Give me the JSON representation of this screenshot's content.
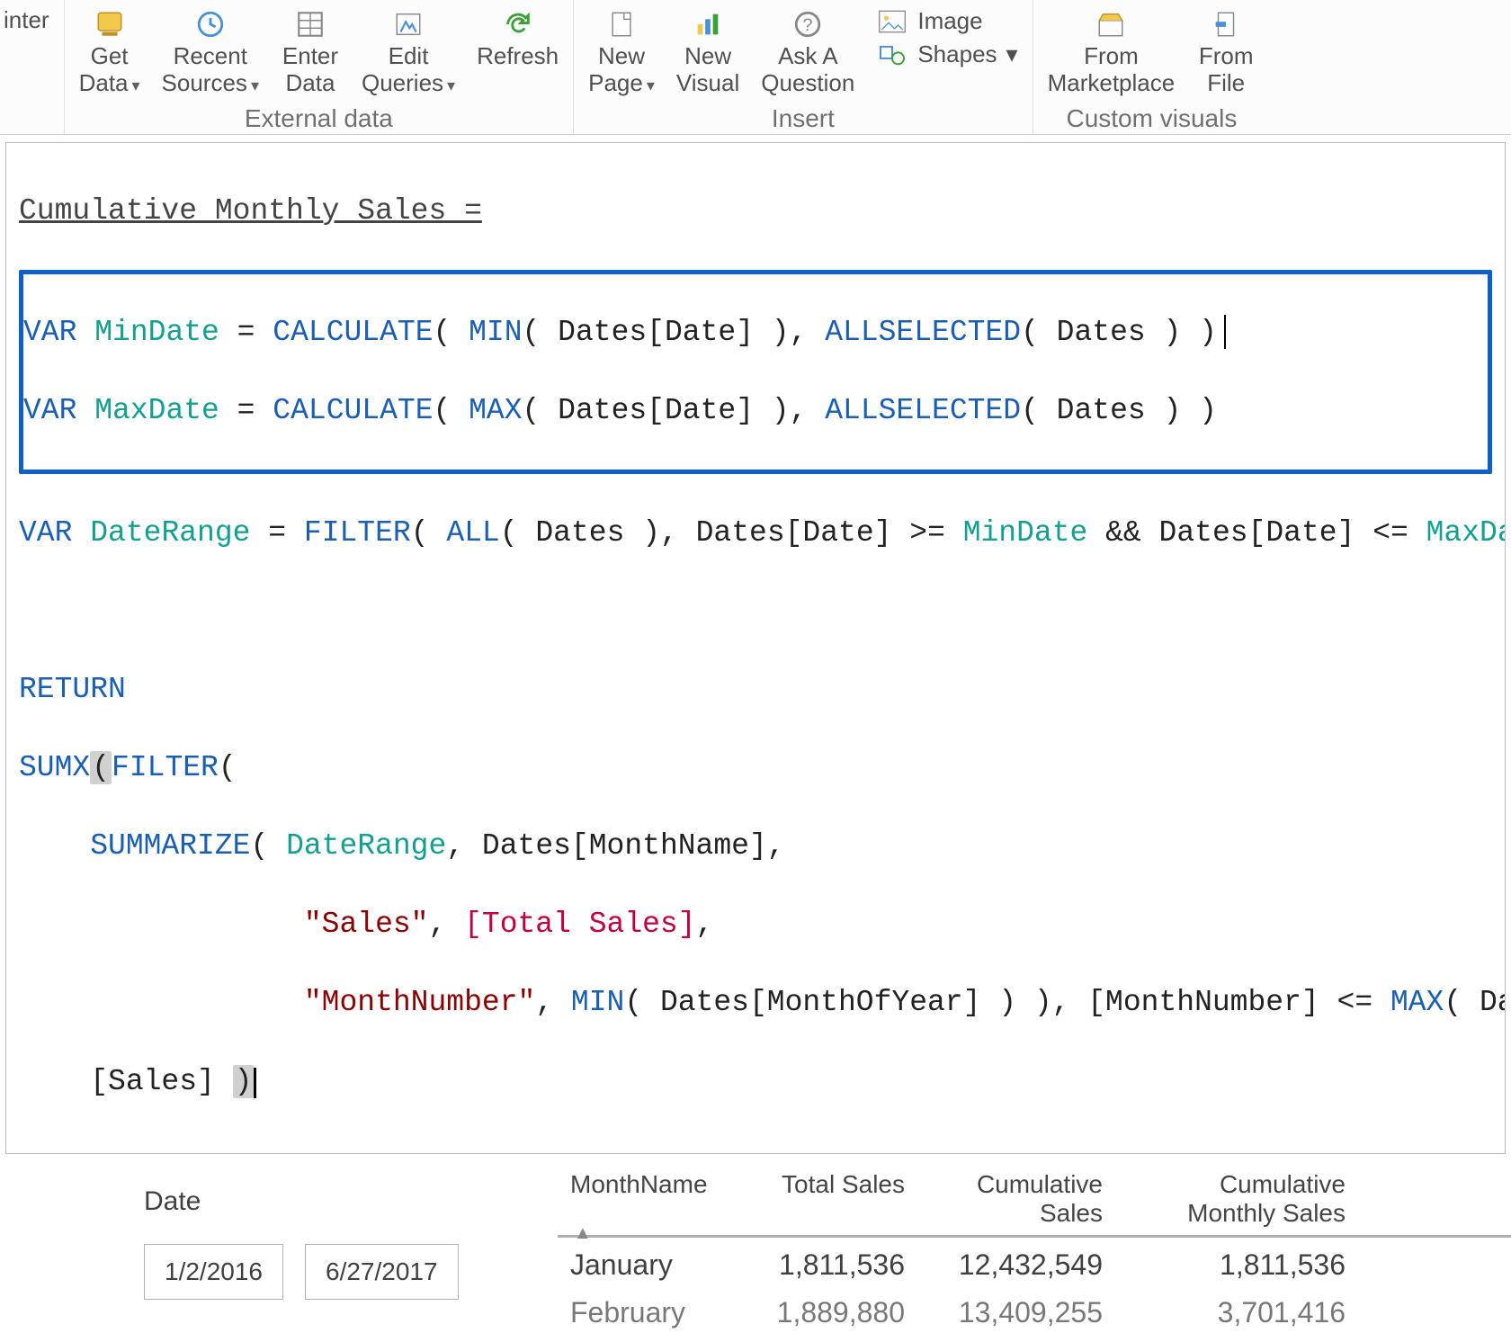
{
  "ribbon": {
    "painter": {
      "label": "inter"
    },
    "get_data": {
      "label": "Get\nData"
    },
    "recent_sources": {
      "label": "Recent\nSources"
    },
    "enter_data": {
      "label": "Enter\nData"
    },
    "edit_queries": {
      "label": "Edit\nQueries"
    },
    "refresh": {
      "label": "Refresh"
    },
    "external_data_section": "External data",
    "new_page": {
      "label": "New\nPage"
    },
    "new_visual": {
      "label": "New\nVisual"
    },
    "ask_a_question": {
      "label": "Ask A\nQuestion"
    },
    "image": {
      "label": "Image"
    },
    "shapes": {
      "label": "Shapes"
    },
    "insert_section": "Insert",
    "from_marketplace": {
      "label": "From\nMarketplace"
    },
    "from_file": {
      "label": "From\nFile"
    },
    "custom_visuals_section": "Custom visuals"
  },
  "formula": {
    "line1_name": "Cumulative Monthly Sales =",
    "var1": {
      "kw": "VAR",
      "name": "MinDate",
      "eq": " = ",
      "calc": "CALCULATE",
      "min": "MIN",
      "arg": "Dates[Date]",
      "allsel": "ALLSELECTED",
      "dates": "Dates"
    },
    "var2": {
      "kw": "VAR",
      "name": "MaxDate",
      "eq": " = ",
      "calc": "CALCULATE",
      "max": "MAX",
      "arg": "Dates[Date]",
      "allsel": "ALLSELECTED",
      "dates": "Dates"
    },
    "var3": {
      "kw": "VAR",
      "name": "DateRange",
      "eq": " = ",
      "filter": "FILTER",
      "all": "ALL",
      "dates": "Dates",
      "col": "Dates[Date]",
      "ge": ">=",
      "min": "MinDate",
      "and": "&&",
      "le": "<=",
      "max": "MaxDate"
    },
    "return_kw": "RETURN",
    "sumx": "SUMX",
    "filter": "FILTER",
    "summarize": "SUMMARIZE",
    "daterange": "DateRange",
    "monthname_col": "Dates[MonthName]",
    "sales_str": "\"Sales\"",
    "total_sales_measure": "[Total Sales]",
    "monthnumber_str": "\"MonthNumber\"",
    "min_fn": "MIN",
    "monthofyear_col": "Dates[MonthOfYear]",
    "monthnumber_ref": "[MonthNumber]",
    "le": "<=",
    "max_fn": "MAX",
    "dates_month_partial": "Dates[Month",
    "sales_ref": "[Sales]"
  },
  "slicer": {
    "title": "Date",
    "start": "1/2/2016",
    "end": "6/27/2017"
  },
  "table": {
    "headers": {
      "month": "MonthName",
      "total": "Total Sales",
      "cum": "Cumulative Sales",
      "cms": "Cumulative Monthly Sales"
    },
    "rows": [
      {
        "month": "January",
        "total": "1,811,536",
        "cum": "12,432,549",
        "cms": "1,811,536"
      },
      {
        "month": "February",
        "total": "1,889,880",
        "cum": "13,409,255",
        "cms": "3,701,416"
      }
    ]
  }
}
